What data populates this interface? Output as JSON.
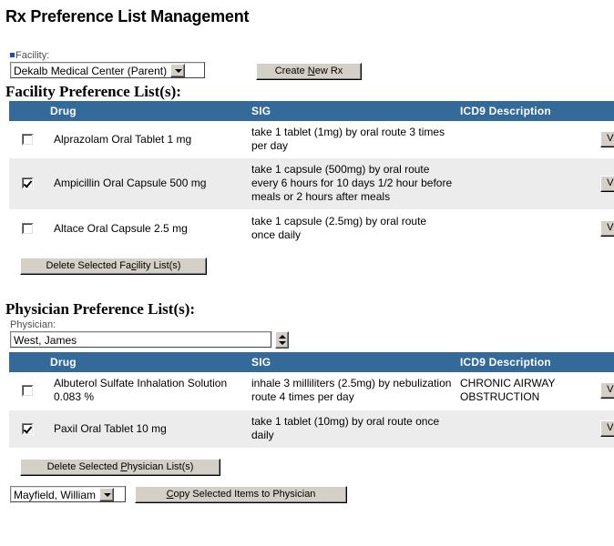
{
  "page": {
    "title": "Rx Preference List Management"
  },
  "facility": {
    "label": "Facility:",
    "marker_color": "#1c4bb5",
    "selected": "Dekalb Medical Center (Parent)",
    "arrow_icon": "chevron-down-icon"
  },
  "toolbar": {
    "create_new_rx": {
      "pre": "Create ",
      "key": "N",
      "post": "ew Rx"
    }
  },
  "facility_section": {
    "heading": "Facility Preference List(s):",
    "columns": {
      "check": "",
      "drug": "Drug",
      "sig": "SIG",
      "icd9": "ICD9 Description",
      "action": ""
    },
    "rows": [
      {
        "checked": false,
        "drug": "Alprazolam Oral Tablet 1 mg",
        "sig": "take 1 tablet (1mg) by oral route 3 times per day",
        "icd9": "",
        "action": "View"
      },
      {
        "checked": true,
        "drug": "Ampicillin Oral Capsule 500 mg",
        "sig": "take 1 capsule (500mg) by oral route every 6 hours for 10 days 1/2 hour before meals or 2 hours after meals",
        "icd9": "",
        "action": "View"
      },
      {
        "checked": false,
        "drug": "Altace Oral Capsule 2.5 mg",
        "sig": "take 1 capsule (2.5mg) by oral route once daily",
        "icd9": "",
        "action": "View"
      }
    ],
    "delete_button": {
      "pre": "Delete Selected Fa",
      "key": "c",
      "post": "ility List(s)"
    }
  },
  "physician_section": {
    "heading": "Physician Preference List(s):",
    "selector_label": "Physician:",
    "selected_physician": "West, James",
    "spinner_icon": "spinner-up-down-icon",
    "columns": {
      "check": "",
      "drug": "Drug",
      "sig": "SIG",
      "icd9": "ICD9 Description",
      "action": ""
    },
    "rows": [
      {
        "checked": false,
        "drug": "Albuterol Sulfate Inhalation Solution 0.083 %",
        "sig": "inhale 3 milliliters (2.5mg) by nebulization route 4 times per day",
        "icd9": "CHRONIC AIRWAY OBSTRUCTION",
        "action": "View"
      },
      {
        "checked": true,
        "drug": "Paxil Oral Tablet 10 mg",
        "sig": "take 1 tablet (10mg) by oral route once daily",
        "icd9": "",
        "action": "View"
      }
    ],
    "delete_button": {
      "pre": "Delete Selected ",
      "key": "P",
      "post": "hysician List(s)"
    },
    "copy_target_physician": "Mayfield, William",
    "copy_button": {
      "pre": "",
      "key": "C",
      "post": "opy Selected Items to Physician"
    }
  },
  "theme": {
    "header_blue": "#336a99",
    "alt_row": "#ececec",
    "button_face": "#d4d0c8"
  }
}
